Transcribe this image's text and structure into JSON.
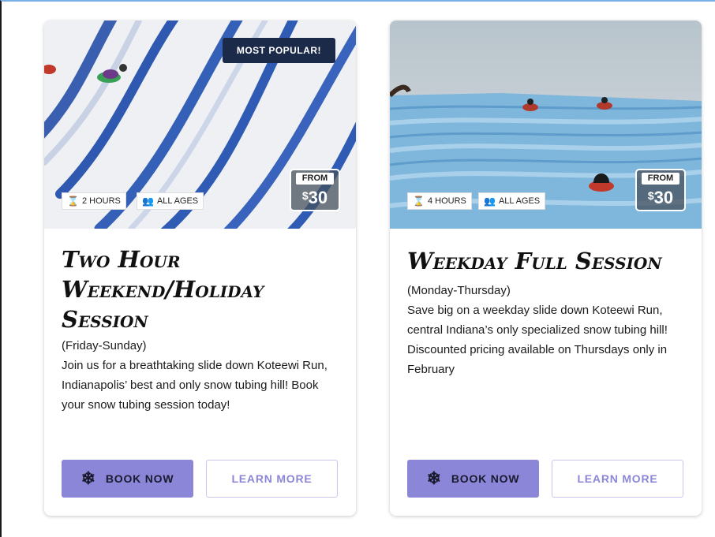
{
  "cards": [
    {
      "badge": "MOST POPULAR!",
      "duration": "2 HOURS",
      "ages": "ALL AGES",
      "price_from": "FROM",
      "price_currency": "$",
      "price_amount": "30",
      "title_lines": [
        "Two Hour",
        "Weekend/Holiday",
        "Session"
      ],
      "days": "(Friday-Sunday)",
      "description": "Join us for a breathtaking slide down Koteewi Run, Indianapolis’ best and only snow tubing hill! Book your snow tubing session today!",
      "book_label": "BOOK NOW",
      "learn_label": "LEARN MORE"
    },
    {
      "duration": "4 HOURS",
      "ages": "ALL AGES",
      "price_from": "FROM",
      "price_currency": "$",
      "price_amount": "30",
      "title_lines": [
        "Weekday Full Session"
      ],
      "days": "(Monday-Thursday)",
      "description": "Save big on a weekday slide down Koteewi Run, central Indiana’s only specialized snow tubing hill!",
      "description_extra": "Discounted pricing available on Thursdays only in February",
      "book_label": "BOOK NOW",
      "learn_label": "LEARN MORE"
    }
  ],
  "icons": {
    "hourglass": "hourglass-icon",
    "group": "group-icon",
    "snowflake": "snowflake-icon"
  },
  "colors": {
    "accent": "#8c86d8",
    "badge_bg": "#1c2a4a"
  }
}
